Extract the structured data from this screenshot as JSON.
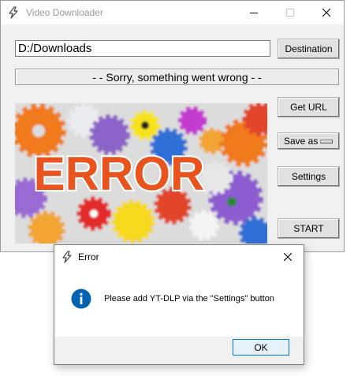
{
  "main_window": {
    "title": "Video Downloader",
    "path_value": "D:/Downloads",
    "destination_label": "Destination",
    "status_text": "- - Sorry, something went wrong - -",
    "get_url_label": "Get URL",
    "save_as_label": "Save as",
    "settings_label": "Settings",
    "start_label": "START",
    "image_text": "ERROR"
  },
  "dialog": {
    "title": "Error",
    "message": "Please add YT-DLP via the \"Settings\" button",
    "ok_label": "OK"
  },
  "colors": {
    "error_text": "#e8531e",
    "info_icon": "#0063b1",
    "ok_border": "#0078d7"
  },
  "icons": [
    "app-icon",
    "minimize-icon",
    "maximize-icon",
    "close-icon",
    "info-icon"
  ]
}
